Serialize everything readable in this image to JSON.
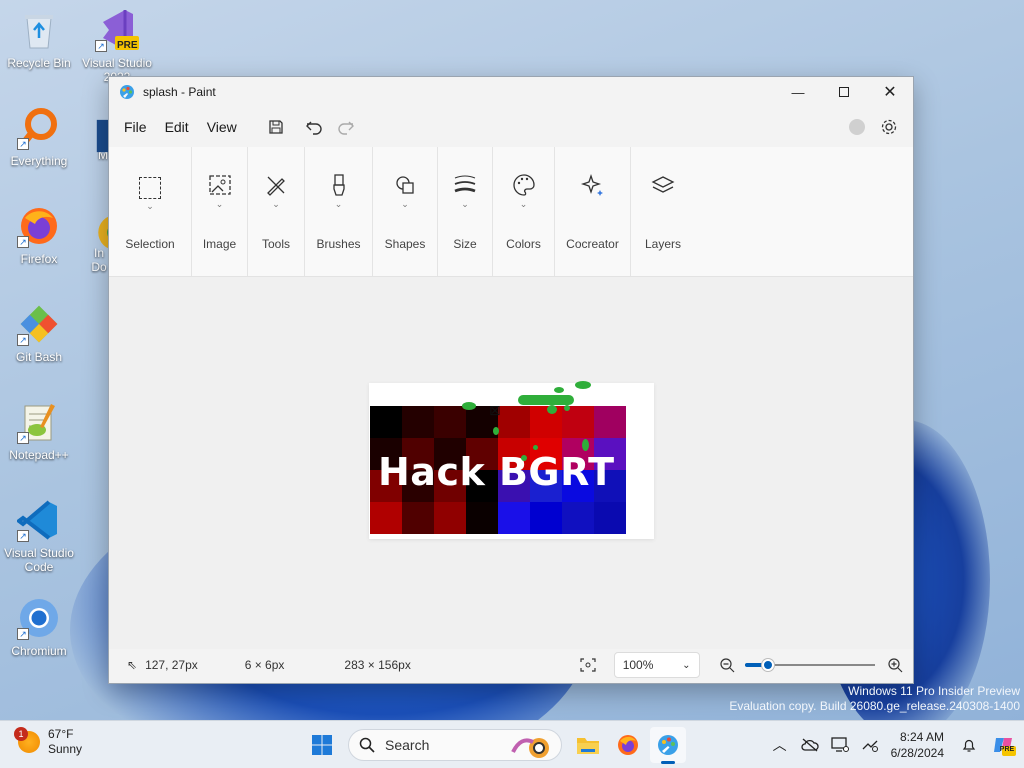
{
  "desktop": {
    "icons": [
      {
        "label": "Recycle Bin"
      },
      {
        "label": "Visual Studio 2022",
        "badge": "PRE"
      },
      {
        "label": "Everything"
      },
      {
        "label": "M"
      },
      {
        "label": "Firefox"
      },
      {
        "label": "In Do"
      },
      {
        "label": "Git Bash"
      },
      {
        "label": "Notepad++"
      },
      {
        "label": "Visual Studio Code"
      },
      {
        "label": "Chromium"
      }
    ]
  },
  "window": {
    "title": "splash - Paint",
    "menu": {
      "file": "File",
      "edit": "Edit",
      "view": "View"
    },
    "ribbon": {
      "selection": "Selection",
      "image": "Image",
      "tools": "Tools",
      "brushes": "Brushes",
      "shapes": "Shapes",
      "size": "Size",
      "colors": "Colors",
      "cocreator": "Cocreator",
      "layers": "Layers"
    },
    "canvas": {
      "image_text": "Hack BGRT"
    },
    "status": {
      "cursor_pos": "127, 27px",
      "selection_size": "6 × 6px",
      "canvas_size": "283 × 156px",
      "zoom": "100%",
      "zoom_slider_fraction": 0.17
    }
  },
  "watermark": {
    "line1": "Windows 11 Pro Insider Preview",
    "line2": "Evaluation copy. Build 26080.ge_release.240308-1400"
  },
  "taskbar": {
    "weather": {
      "temp": "67°F",
      "condition": "Sunny",
      "badge": "1"
    },
    "search_placeholder": "Search",
    "clock": {
      "time": "8:24 AM",
      "date": "6/28/2024"
    },
    "copilot_badge": "PRE"
  },
  "colors": {
    "accent": "#005fb8",
    "brush_green": "#2fae3a"
  }
}
